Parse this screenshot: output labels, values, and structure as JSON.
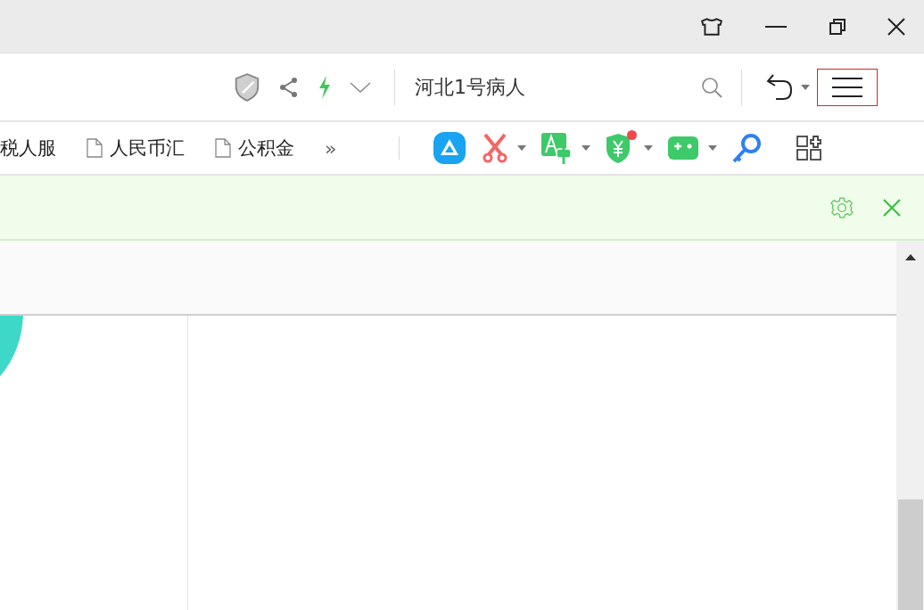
{
  "address_bar": {
    "search": {
      "value": "河北1号病人"
    },
    "menu_button": {
      "highlighted": true
    }
  },
  "bookmarks": {
    "items": [
      {
        "label": "税人服",
        "kind": "text"
      },
      {
        "label": "人民币汇",
        "kind": "page"
      },
      {
        "label": "公积金",
        "kind": "page"
      }
    ],
    "more": "»"
  },
  "extensions": [
    {
      "kind": "cloud",
      "dropdown": false,
      "notification": false
    },
    {
      "kind": "scissors",
      "dropdown": true,
      "notification": false
    },
    {
      "kind": "translate",
      "dropdown": true,
      "notification": false
    },
    {
      "kind": "wallet",
      "dropdown": true,
      "notification": true
    },
    {
      "kind": "game",
      "dropdown": true,
      "notification": false
    },
    {
      "kind": "key",
      "dropdown": false,
      "notification": false
    }
  ]
}
